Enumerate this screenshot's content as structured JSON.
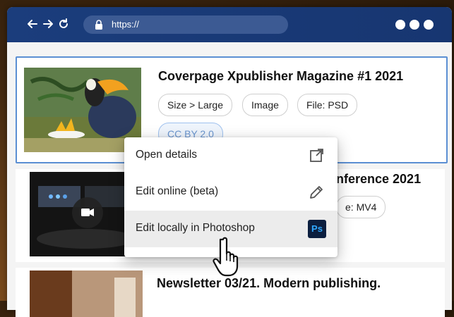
{
  "browser": {
    "url": "https://"
  },
  "items": [
    {
      "title": "Coverpage Xpublisher Magazine #1 2021",
      "chips": [
        "Size > Large",
        "Image",
        "File: PSD"
      ],
      "license": "CC BY 2.0"
    },
    {
      "title": "nference 2021",
      "chips": [
        "e: MV4"
      ]
    },
    {
      "title": "Newsletter 03/21. Modern publishing.",
      "chips": []
    }
  ],
  "context_menu": {
    "items": [
      {
        "label": "Open details",
        "icon": "open-external-icon"
      },
      {
        "label": "Edit online (beta)",
        "icon": "pencil-icon"
      },
      {
        "label": "Edit locally in Photoshop",
        "icon": "photoshop-icon",
        "badge": "Ps"
      }
    ]
  },
  "colors": {
    "browser_bar": "#1b3d7c",
    "selection": "#5b8fd3",
    "accent_ps": "#31a8ff"
  }
}
